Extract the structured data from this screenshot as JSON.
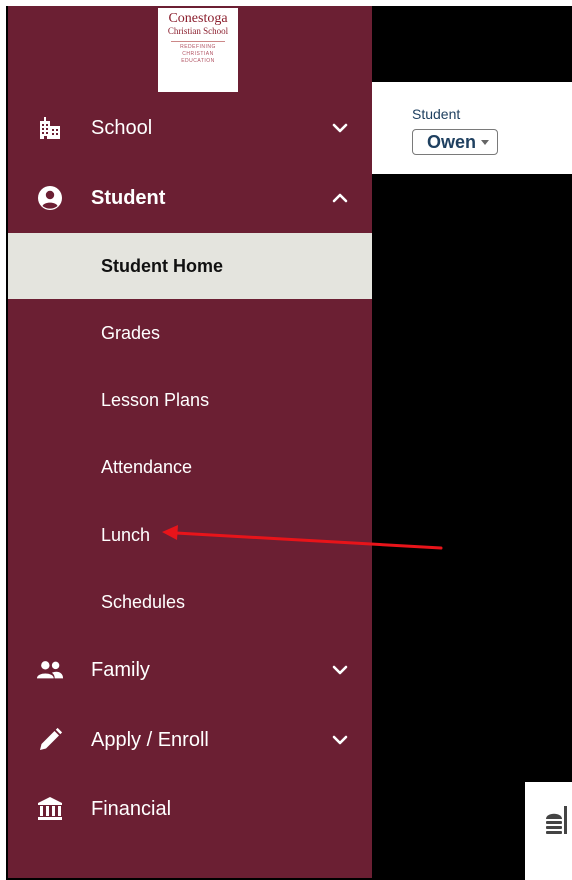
{
  "logo": {
    "line1": "Conestoga",
    "line2": "Christian School",
    "tagline": [
      "REDEFINING",
      "CHRISTIAN",
      "EDUCATION"
    ]
  },
  "nav": {
    "school": {
      "label": "School",
      "icon": "building-icon",
      "chevron": "chevron-down-icon"
    },
    "student": {
      "label": "Student",
      "icon": "user-circle-icon",
      "chevron": "chevron-up-icon"
    },
    "family": {
      "label": "Family",
      "icon": "users-icon",
      "chevron": "chevron-down-icon"
    },
    "apply": {
      "label": "Apply / Enroll",
      "icon": "pencil-icon",
      "chevron": "chevron-down-icon"
    },
    "financial": {
      "label": "Financial",
      "icon": "bank-icon"
    }
  },
  "student_menu": [
    {
      "label": "Student Home",
      "active": true
    },
    {
      "label": "Grades"
    },
    {
      "label": "Lesson Plans"
    },
    {
      "label": "Attendance"
    },
    {
      "label": "Lunch"
    },
    {
      "label": "Schedules"
    }
  ],
  "header": {
    "student_label": "Student",
    "selected_student": "Owen"
  },
  "colors": {
    "sidebar": "#6b1f33",
    "active_item_bg": "#e4e4de",
    "arrow": "#e8141a",
    "header_text": "#1f4060"
  }
}
